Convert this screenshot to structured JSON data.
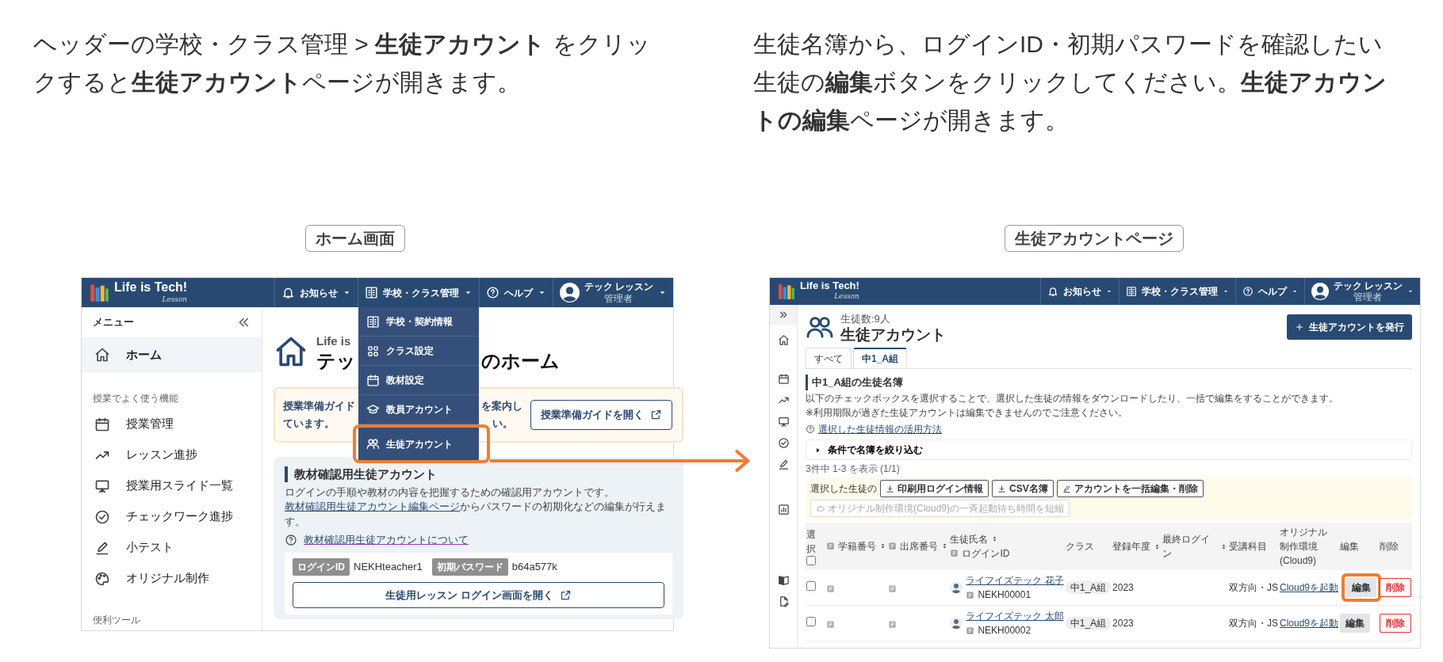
{
  "instructions": [
    {
      "text": "ヘッダーの学校・クラス管理 > **生徒アカウント** をクリックすると**生徒アカウント**ページが開きます。"
    },
    {
      "text": "生徒名簿から、ログインID・初期パスワードを確認したい生徒の**編集**ボタンをクリックしてください。**生徒アカウントの編集**ページが開きます。"
    }
  ],
  "home_screen": {
    "caption": "ホーム画面",
    "header": {
      "logo_text": "Life is Tech!",
      "logo_sub": "Lesson",
      "nav": [
        {
          "label": "お知らせ"
        },
        {
          "label": "学校・クラス管理",
          "menu": [
            {
              "label": "学校・契約情報",
              "highlighted": false
            },
            {
              "label": "クラス設定",
              "highlighted": false
            },
            {
              "label": "教材設定",
              "highlighted": false
            },
            {
              "label": "教員アカウント",
              "highlighted": false
            },
            {
              "label": "生徒アカウント",
              "highlighted": true
            }
          ]
        },
        {
          "label": "ヘルプ"
        }
      ],
      "user": {
        "name": "テック レッスン",
        "role": "管理者"
      }
    },
    "sidebar": {
      "title": "メニュー",
      "sections": [
        {
          "items": [
            {
              "label": "ホーム",
              "selected": true
            }
          ]
        },
        {
          "heading": "授業でよく使う機能",
          "items": [
            {
              "label": "授業管理",
              "selected": false
            },
            {
              "label": "レッスン進捗",
              "selected": false
            },
            {
              "label": "授業用スライド一覧",
              "selected": false
            },
            {
              "label": "チェックワーク進捗",
              "selected": false
            },
            {
              "label": "小テスト",
              "selected": false
            },
            {
              "label": "オリジナル制作",
              "selected": false
            }
          ]
        },
        {
          "heading": "便利ツール"
        }
      ]
    },
    "subtitle": "Life is",
    "title_parts": [
      "テッ",
      "のホーム"
    ],
    "guide": {
      "lines": [
        [
          "授業準備ガイド",
          "を案内し"
        ],
        [
          "ています。",
          "い。"
        ]
      ],
      "button": "授業準備ガイドを開く"
    },
    "card": {
      "title": "教材確認用生徒アカウント",
      "description": "ログインの手順や教材の内容を把握するための確認用アカウントです。",
      "edit_link": "教材確認用生徒アカウント編集ページ",
      "description_after": "からパスワードの初期化などの編集が行えます。",
      "help_link": "教材確認用生徒アカウントについて",
      "login": [
        {
          "label": "ログインID",
          "value": "NEKHteacher1"
        },
        {
          "label": "初期パスワード",
          "value": "b64a577k"
        }
      ],
      "button": "生徒用レッスン ログイン画面を開く"
    }
  },
  "account_page": {
    "caption": "生徒アカウントページ",
    "header": {
      "logo_text": "Life is Tech!",
      "logo_sub": "Lesson",
      "nav": [
        {
          "label": "お知らせ"
        },
        {
          "label": "学校・クラス管理"
        },
        {
          "label": "ヘルプ"
        }
      ],
      "user": {
        "name": "テック レッスン",
        "role": "管理者"
      }
    },
    "count": "生徒数:9人",
    "title": "生徒アカウント",
    "issue_button": "生徒アカウントを発行",
    "tabs": [
      {
        "label": "すべて",
        "selected": false
      },
      {
        "label": "中1_A組",
        "selected": true
      }
    ],
    "roster": {
      "heading": "中1_A組の生徒名簿",
      "notes": [
        "以下のチェックボックスを選択することで、選択した生徒の情報をダウンロードしたり、一括で編集をすることができます。",
        "※利用期限が過ぎた生徒アカウントは編集できませんのでご注意ください。"
      ],
      "help_link": "選択した生徒情報の活用方法",
      "filter": {
        "label": "条件で名簿を絞り込む",
        "expanded": false
      },
      "result_count": "3件中 1-3 を表示 (1/1)",
      "bulk": {
        "label": "選択した生徒の",
        "buttons": [
          {
            "label": "印刷用ログイン情報",
            "disabled": false
          },
          {
            "label": "CSV名簿",
            "disabled": false
          },
          {
            "label": "アカウントを一括編集・削除",
            "disabled": false
          },
          {
            "label": "オリジナル制作環境(Cloud9)の一斉起動待ち時間を短縮",
            "disabled": true
          }
        ]
      },
      "table": {
        "select_all": false,
        "columns": [
          {
            "label": "選択",
            "sortable": false
          },
          {
            "label": "学籍番号",
            "sortable": true
          },
          {
            "label": "出席番号",
            "sortable": true
          },
          {
            "label": "生徒氏名",
            "sub_label": "ログインID",
            "sortable": true
          },
          {
            "label": "クラス",
            "sortable": false
          },
          {
            "label": "登録年度",
            "sortable": true
          },
          {
            "label": "最終ログイン",
            "sortable": true
          },
          {
            "label": "受講科目",
            "sortable": false
          },
          {
            "label": "オリジナル制作環境(Cloud9)",
            "sortable": false
          },
          {
            "label": "編集",
            "sortable": false
          },
          {
            "label": "削除",
            "sortable": false
          }
        ],
        "rows": [
          {
            "selected": false,
            "name": "ライフイズテック 花子",
            "login_id": "NEKH00001",
            "class": "中1_A組",
            "year": "2023",
            "subject": "双方向・JS",
            "cloud9_link": "Cloud9を起動",
            "edit": "編集",
            "edit_highlighted": true,
            "delete": "削除"
          },
          {
            "selected": false,
            "name": "ライフイズテック 太郎",
            "login_id": "NEKH00002",
            "class": "中1_A組",
            "year": "2023",
            "subject": "双方向・JS",
            "cloud9_link": "Cloud9を起動",
            "edit": "編集",
            "edit_highlighted": false,
            "delete": "削除"
          }
        ]
      }
    }
  }
}
